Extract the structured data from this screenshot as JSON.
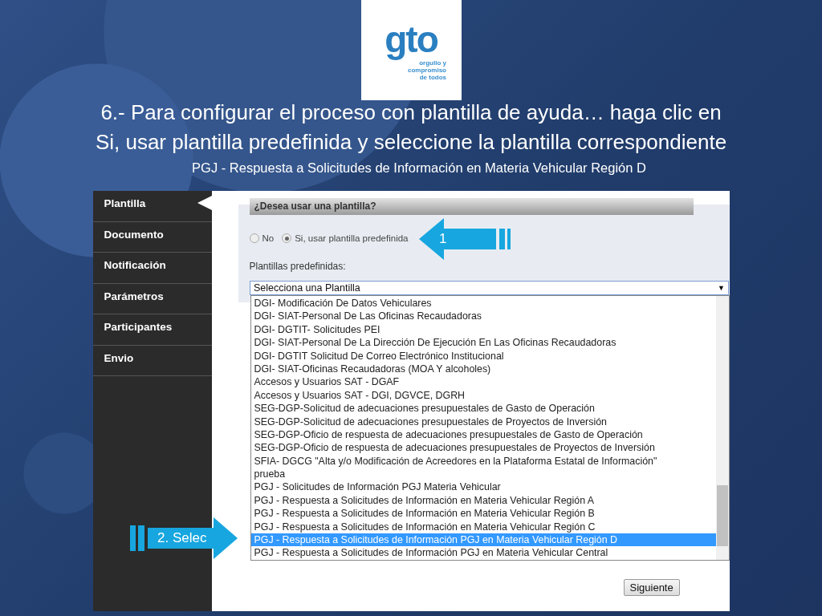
{
  "logo": {
    "wordmark": "gto",
    "tagline": [
      "orgullo y",
      "compromiso",
      "de todos"
    ]
  },
  "title": [
    "6.- Para configurar el proceso con plantilla de ayuda… haga clic en",
    "Si, usar plantilla predefinida y seleccione la plantilla correspondiente"
  ],
  "subtitle": "PGJ - Respuesta a Solicitudes de Información en Materia Vehicular Región D",
  "app": {
    "sidebar": [
      {
        "label": "Plantilla",
        "selected": true
      },
      {
        "label": "Documento",
        "selected": false
      },
      {
        "label": "Notificación",
        "selected": false
      },
      {
        "label": "Parámetros",
        "selected": false
      },
      {
        "label": "Participantes",
        "selected": false
      },
      {
        "label": "Envio",
        "selected": false
      }
    ],
    "question": "¿Desea usar una plantilla?",
    "radios": [
      {
        "label": "No",
        "selected": false
      },
      {
        "label": "Si, usar plantilla predefinida",
        "selected": true
      }
    ],
    "select_label": "Plantillas predefinidas:",
    "select_value": "Selecciona una Plantilla",
    "select_caret": "▼",
    "options": [
      {
        "label": "DGI- Modificación De Datos Vehiculares",
        "selected": false
      },
      {
        "label": "DGI- SIAT-Personal De Las Oficinas Recaudadoras",
        "selected": false
      },
      {
        "label": "DGI- DGTIT- Solicitudes PEI",
        "selected": false
      },
      {
        "label": "DGI- SIAT-Personal De La Dirección De Ejecución En Las Oficinas Recaudadoras",
        "selected": false
      },
      {
        "label": "DGI- DGTIT Solicitud De Correo Electrónico Institucional",
        "selected": false
      },
      {
        "label": "DGI- SIAT-Oficinas Recaudadoras (MOA Y alcoholes)",
        "selected": false
      },
      {
        "label": "Accesos y Usuarios SAT - DGAF",
        "selected": false
      },
      {
        "label": "Accesos y Usuarios SAT - DGI, DGVCE, DGRH",
        "selected": false
      },
      {
        "label": "SEG-DGP-Solicitud de adecuaciones presupuestales de Gasto de Operación",
        "selected": false
      },
      {
        "label": "SEG-DGP-Solicitud de adecuaciones presupuestales de Proyectos de Inversión",
        "selected": false
      },
      {
        "label": "SEG-DGP-Oficio de respuesta de adecuaciones presupuestales de Gasto de Operación",
        "selected": false
      },
      {
        "label": "SEG-DGP-Oficio de respuesta de adecuaciones presupuestales de Proyectos de Inversión",
        "selected": false
      },
      {
        "label": "SFIA- DGCG \"Alta y/o Modificación de Acreedores en la Plataforma Estatal de Información\"",
        "selected": false
      },
      {
        "label": "prueba",
        "selected": false
      },
      {
        "label": "PGJ - Solicitudes de Información PGJ Materia Vehicular",
        "selected": false
      },
      {
        "label": "PGJ - Respuesta a Solicitudes de Información en Materia Vehicular Región A",
        "selected": false
      },
      {
        "label": "PGJ - Respuesta a Solicitudes de Información en Materia Vehicular Región B",
        "selected": false
      },
      {
        "label": "PGJ - Respuesta a Solicitudes de Información en Materia Vehicular Región C",
        "selected": false
      },
      {
        "label": "PGJ - Respuesta a Solicitudes de Información PGJ en Materia Vehicular Región D",
        "selected": true
      },
      {
        "label": "PGJ - Respuesta a Solicitudes de Información PGJ en Materia Vehicular Central",
        "selected": false
      }
    ],
    "next_button": "Siguiente"
  },
  "callouts": [
    {
      "text": "1",
      "kind": "leftward"
    },
    {
      "text": "2. Selec",
      "kind": "rightward"
    }
  ]
}
